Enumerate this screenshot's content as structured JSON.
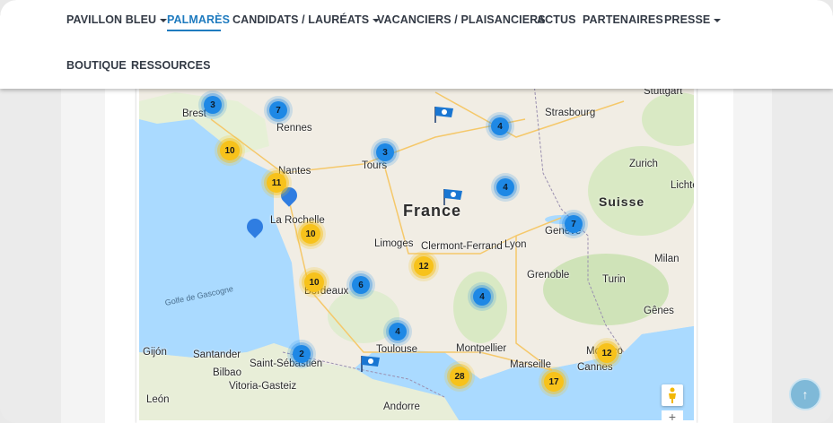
{
  "nav": {
    "items": [
      {
        "label": "PAVILLON BLEU",
        "dropdown": true
      },
      {
        "label": "PALMARÈS",
        "dropdown": false,
        "active": true
      },
      {
        "label": "CANDIDATS / LAURÉATS",
        "dropdown": true
      },
      {
        "label": "VACANCIERS / PLAISANCIERS",
        "dropdown": false
      },
      {
        "label": "ACTUS",
        "dropdown": false
      },
      {
        "label": "PARTENAIRES",
        "dropdown": false
      },
      {
        "label": "PRESSE",
        "dropdown": true
      },
      {
        "label": "BOUTIQUE",
        "dropdown": false
      },
      {
        "label": "RESSOURCES",
        "dropdown": false
      }
    ],
    "accent": "#1f7bbf"
  },
  "map": {
    "countries": [
      "France",
      "Suisse"
    ],
    "sea_label": "Golfe de Gascogne",
    "cities": [
      "Brest",
      "Rennes",
      "Nantes",
      "Tours",
      "Strasbourg",
      "Stuttgart",
      "Zurich",
      "Genève",
      "Lyon",
      "Limoges",
      "Clermont-Ferrand",
      "Grenoble",
      "Milan",
      "Turin",
      "Gênes",
      "Bordeaux",
      "Toulouse",
      "Montpellier",
      "Marseille",
      "Cannes",
      "Monaco",
      "Andorre",
      "Bilbao",
      "Saint-Sébastien",
      "Vitoria-Gasteiz",
      "Santander",
      "Gijón",
      "León",
      "La Rochelle",
      "Lichtenstein"
    ],
    "clusters": [
      {
        "count": "3",
        "color": "blue"
      },
      {
        "count": "7",
        "color": "blue"
      },
      {
        "count": "10",
        "color": "yellow"
      },
      {
        "count": "3",
        "color": "blue"
      },
      {
        "count": "4",
        "color": "blue"
      },
      {
        "count": "11",
        "color": "yellow"
      },
      {
        "count": "4",
        "color": "blue"
      },
      {
        "count": "10",
        "color": "yellow"
      },
      {
        "count": "7",
        "color": "blue"
      },
      {
        "count": "12",
        "color": "yellow"
      },
      {
        "count": "10",
        "color": "yellow"
      },
      {
        "count": "6",
        "color": "blue"
      },
      {
        "count": "4",
        "color": "blue"
      },
      {
        "count": "4",
        "color": "blue"
      },
      {
        "count": "2",
        "color": "blue"
      },
      {
        "count": "28",
        "color": "yellow"
      },
      {
        "count": "17",
        "color": "yellow"
      },
      {
        "count": "12",
        "color": "yellow"
      }
    ],
    "cluster_colors": {
      "blue": "#1e88e5",
      "yellow": "#f7c21b"
    }
  },
  "controls": {
    "pegman_icon": "pegman-icon",
    "zoom_in_label": "+",
    "back_to_top_label": "↑"
  }
}
